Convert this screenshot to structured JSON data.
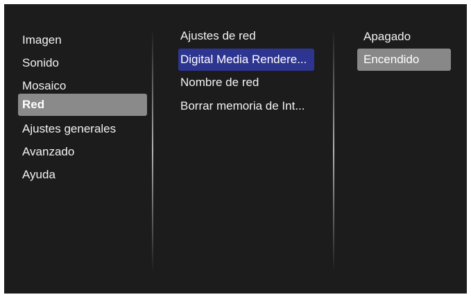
{
  "menu": {
    "main": [
      {
        "label": "Imagen"
      },
      {
        "label": "Sonido"
      },
      {
        "label": "Mosaico"
      },
      {
        "label": "Red"
      },
      {
        "label": "Ajustes generales"
      },
      {
        "label": "Avanzado"
      },
      {
        "label": "Ayuda"
      }
    ],
    "network": [
      {
        "label": "Ajustes de red"
      },
      {
        "label": "Digital Media Rendere..."
      },
      {
        "label": "Nombre de red"
      },
      {
        "label": "Borrar memoria de Int..."
      }
    ],
    "options": [
      {
        "label": "Apagado"
      },
      {
        "label": "Encendido"
      }
    ],
    "selected_main": "Red",
    "selected_network": "Digital Media Rendere...",
    "current_option": "Encendido"
  },
  "colors": {
    "panel_bg": "#1c1c1c",
    "highlight_gray": "#8a8a8a",
    "highlight_blue": "#2e3590",
    "text": "#f2f2f2"
  }
}
